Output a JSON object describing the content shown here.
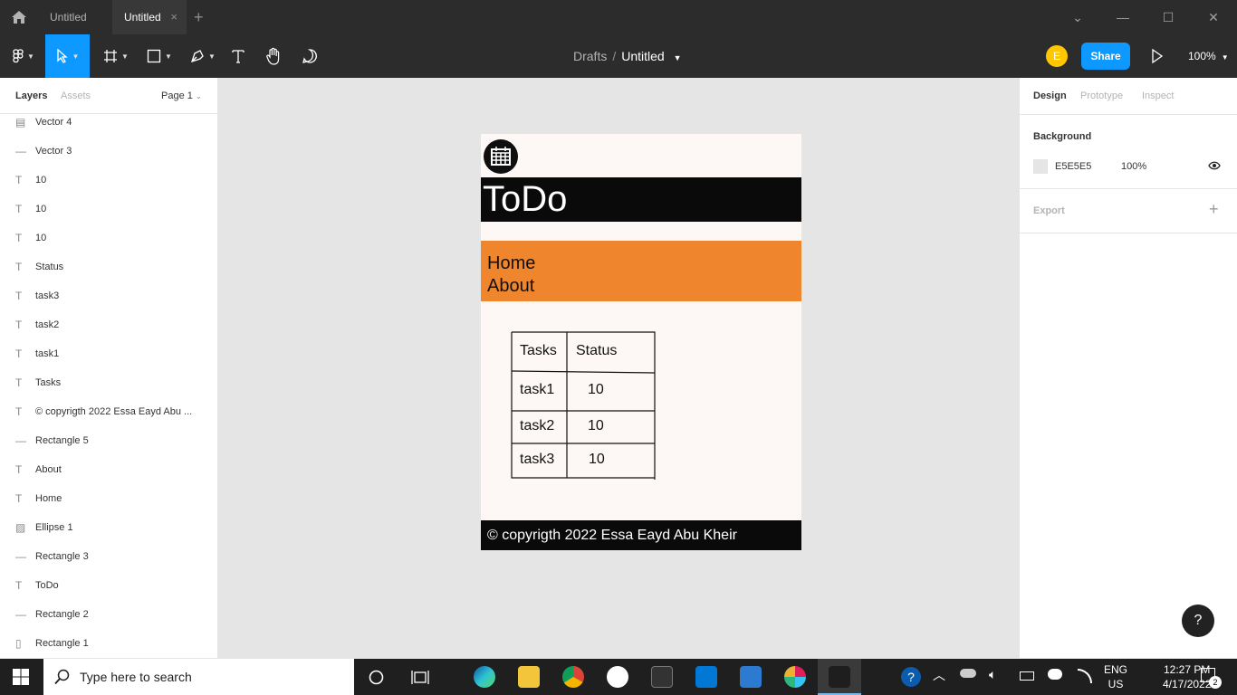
{
  "window": {
    "tabs": [
      {
        "label": "Untitled"
      },
      {
        "label": "Untitled"
      }
    ],
    "close_glyph": "×",
    "new_tab_glyph": "+"
  },
  "toolbar": {
    "breadcrumb": {
      "drafts": "Drafts",
      "separator": "/",
      "file": "Untitled"
    },
    "avatar_initial": "E",
    "share_label": "Share",
    "zoom": "100%",
    "accent": "#0d99ff"
  },
  "left_panel": {
    "tabs": {
      "layers": "Layers",
      "assets": "Assets"
    },
    "page_selector": "Page 1",
    "layers": [
      {
        "name": "Vector 4",
        "icon": "vector-icon"
      },
      {
        "name": "Vector 3",
        "icon": "line-icon"
      },
      {
        "name": "10",
        "icon": "text-icon"
      },
      {
        "name": "10",
        "icon": "text-icon"
      },
      {
        "name": "10",
        "icon": "text-icon"
      },
      {
        "name": "Status",
        "icon": "text-icon"
      },
      {
        "name": "task3",
        "icon": "text-icon"
      },
      {
        "name": "task2",
        "icon": "text-icon"
      },
      {
        "name": "task1",
        "icon": "text-icon"
      },
      {
        "name": "Tasks",
        "icon": "text-icon"
      },
      {
        "name": "© copyrigth 2022 Essa Eayd Abu ...",
        "icon": "text-icon"
      },
      {
        "name": "Rectangle 5",
        "icon": "line-icon"
      },
      {
        "name": "About",
        "icon": "text-icon"
      },
      {
        "name": "Home",
        "icon": "text-icon"
      },
      {
        "name": "Ellipse 1",
        "icon": "image-icon"
      },
      {
        "name": "Rectangle 3",
        "icon": "line-icon"
      },
      {
        "name": "ToDo",
        "icon": "text-icon"
      },
      {
        "name": "Rectangle 2",
        "icon": "line-icon"
      },
      {
        "name": "Rectangle 1",
        "icon": "rectangle-icon"
      }
    ]
  },
  "right_panel": {
    "tabs": {
      "design": "Design",
      "prototype": "Prototype",
      "inspect": "Inspect"
    },
    "background_label": "Background",
    "background_hex": "E5E5E5",
    "background_opacity": "100%",
    "export_label": "Export",
    "export_add": "+"
  },
  "canvas": {
    "background": "#e5e5e5",
    "design": {
      "title": "ToDo",
      "nav": [
        {
          "label": "Home"
        },
        {
          "label": "About"
        }
      ],
      "table": {
        "headers": [
          "Tasks",
          "Status"
        ],
        "rows": [
          [
            "task1",
            "10"
          ],
          [
            "task2",
            "10"
          ],
          [
            "task3",
            "10"
          ]
        ]
      },
      "footer": "© copyrigth 2022 Essa Eayd Abu Kheir",
      "nav_color": "#ef862d"
    }
  },
  "help_label": "?",
  "taskbar": {
    "search_placeholder": "Type here to search",
    "lang": [
      "ENG",
      "US"
    ],
    "time": "12:27 PM",
    "date": "4/17/2022",
    "notifications": "2"
  }
}
